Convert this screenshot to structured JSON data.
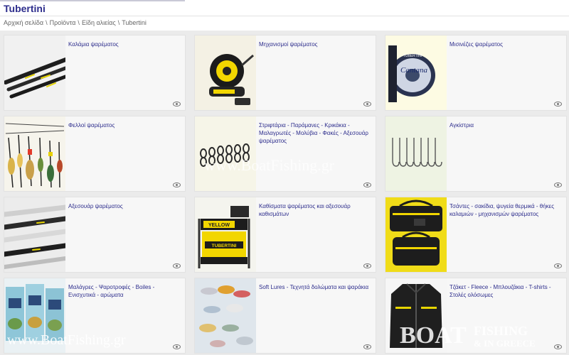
{
  "header": {
    "title": "Tubertini",
    "breadcrumb": [
      "Αρχική σελίδα",
      "Προϊόντα",
      "Είδη αλιείας",
      "Tubertini"
    ],
    "separator": "\\"
  },
  "categories": [
    {
      "label": "Καλάμια ψαρέματος",
      "thumb": "fishing-rods"
    },
    {
      "label": "Μηχανισμοί ψαρέματος",
      "thumb": "fishing-reel"
    },
    {
      "label": "Μισινέζες ψαρέματος",
      "thumb": "fishing-line-spool"
    },
    {
      "label": "Φελλοί ψαρέματος",
      "thumb": "fishing-floats"
    },
    {
      "label": "Στριφτάρια - Παράμανες - Κρικάκια - Μαλαγρωτές - Μολύβια - Φακές - Αξεσουάρ ψαρέματος",
      "thumb": "swivels"
    },
    {
      "label": "Αγκίστρια",
      "thumb": "hooks"
    },
    {
      "label": "Αξεσουάρ ψαρέματος",
      "thumb": "rod-sections"
    },
    {
      "label": "Καθίσματα ψαρέματος και αξεσουάρ καθισμάτων",
      "thumb": "fishing-seatbox"
    },
    {
      "label": "Τσάντες - σακίδια, ψυγεία θερμικά - θήκες καλαμιών - μηχανισμών ψαρέματος",
      "thumb": "fishing-bags"
    },
    {
      "label": "Μαλάγρες - Ψαροτροφές - Boiles - Ενισχυτικά - αρώματα",
      "thumb": "groundbait-bags"
    },
    {
      "label": "Soft Lures - Τεχνητά δολώματα και ψαράκια",
      "thumb": "soft-lures"
    },
    {
      "label": "Τζάκετ - Fleece - Μπλουζάκια - T-shirts - Στολές ολόσωμες",
      "thumb": "fishing-jacket"
    }
  ],
  "thumb_text": {
    "line_brand": "TUBERTINI",
    "line_name": "Cantana",
    "seat_brand": "TUBERTINI",
    "seat_yellow": "YELLOW"
  },
  "watermarks": {
    "site": "www.BoatFishing.gr",
    "logo_top": "FISHING",
    "logo_bottom": "& IN GREECE",
    "logo_left": "BOAT"
  },
  "colors": {
    "accent": "#2d2d8c",
    "card_bg": "#f7f7f7",
    "grid_bg": "#ebebeb"
  }
}
